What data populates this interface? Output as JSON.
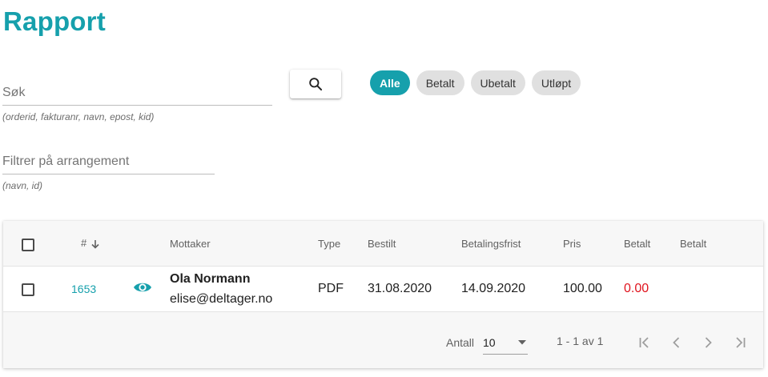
{
  "page": {
    "title": "Rapport"
  },
  "search": {
    "placeholder": "Søk",
    "hint": "(orderid, fakturanr, navn, epost, kid)"
  },
  "event_filter": {
    "placeholder": "Filtrer på arrangement",
    "hint": "(navn, id)"
  },
  "status_chips": [
    {
      "label": "Alle",
      "active": true
    },
    {
      "label": "Betalt",
      "active": false
    },
    {
      "label": "Ubetalt",
      "active": false
    },
    {
      "label": "Utløpt",
      "active": false
    }
  ],
  "table": {
    "columns": {
      "number": "#",
      "recipient": "Mottaker",
      "type": "Type",
      "ordered": "Bestilt",
      "due": "Betalingsfrist",
      "price": "Pris",
      "paid": "Betalt",
      "paid2": "Betalt"
    },
    "rows": [
      {
        "order_id": "1653",
        "name": "Ola Normann",
        "email": "elise@deltager.no",
        "type": "PDF",
        "ordered": "31.08.2020",
        "due": "14.09.2020",
        "price": "100.00",
        "paid": "0.00",
        "paid2": ""
      }
    ]
  },
  "pagination": {
    "rows_label": "Antall",
    "rows_value": "10",
    "range": "1 - 1 av 1"
  },
  "colors": {
    "accent": "#16a0ac",
    "negative": "#e0141e",
    "chip_bg": "#e0e0e0"
  }
}
